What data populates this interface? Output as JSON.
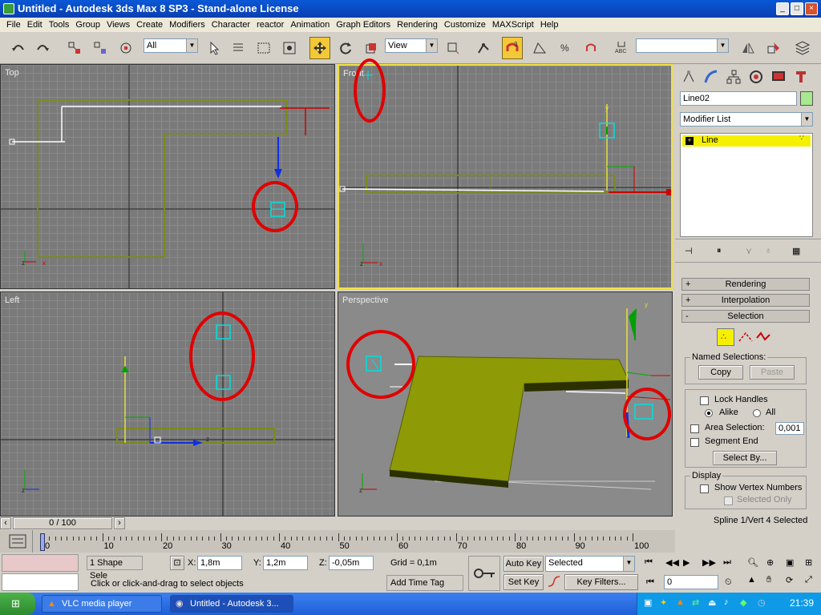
{
  "window": {
    "title": "Untitled - Autodesk 3ds Max 8 SP3  - Stand-alone License",
    "minimize": "_",
    "maximize": "□",
    "close": "×"
  },
  "menu": [
    "File",
    "Edit",
    "Tools",
    "Group",
    "Views",
    "Create",
    "Modifiers",
    "Character",
    "reactor",
    "Animation",
    "Graph Editors",
    "Rendering",
    "Customize",
    "MAXScript",
    "Help"
  ],
  "toolbar": {
    "selection_filter": "All",
    "ref_coord": "View",
    "named_selection": ""
  },
  "viewports": {
    "top": "Top",
    "front": "Front",
    "left": "Left",
    "perspective": "Perspective"
  },
  "command_panel": {
    "object_name": "Line02",
    "object_color": "#a8e890",
    "modifier_list": "Modifier List",
    "stack_item": "Line",
    "rollouts": {
      "rendering": "Rendering",
      "interpolation": "Interpolation",
      "selection": "Selection"
    },
    "signs": {
      "plus": "+",
      "minus": "-"
    },
    "named_selections": {
      "label": "Named Selections:",
      "copy": "Copy",
      "paste": "Paste"
    },
    "lock_handles": "Lock Handles",
    "alike": "Alike",
    "all": "All",
    "area_selection": "Area Selection:",
    "area_value": "0,001",
    "segment_end": "Segment End",
    "select_by": "Select By...",
    "display": {
      "label": "Display",
      "show_vertex_numbers": "Show Vertex Numbers",
      "selected_only": "Selected Only"
    },
    "status": "Spline 1/Vert 4 Selected"
  },
  "timeline": {
    "frame_counter": "0 / 100",
    "ticks": [
      "0",
      "10",
      "20",
      "30",
      "40",
      "50",
      "60",
      "70",
      "80",
      "90",
      "100"
    ]
  },
  "statusbar": {
    "selection_count": "1 Shape Sele",
    "x_label": "X:",
    "x_value": "1,8m",
    "y_label": "Y:",
    "y_value": "1,2m",
    "z_label": "Z:",
    "z_value": "-0,05m",
    "grid": "Grid = 0,1m",
    "prompt": "Click or click-and-drag to select objects",
    "add_time_tag": "Add Time Tag",
    "auto_key": "Auto Key",
    "set_key": "Set Key",
    "key_mode": "Selected",
    "key_filters": "Key Filters...",
    "frame": "0"
  },
  "taskbar": {
    "tasks": [
      "VLC media player",
      "Untitled - Autodesk 3..."
    ],
    "clock": "21:39"
  },
  "colors": {
    "accent": "#f0e040",
    "highlight_ring": "#e00000",
    "shape": "#8a9a1a"
  }
}
